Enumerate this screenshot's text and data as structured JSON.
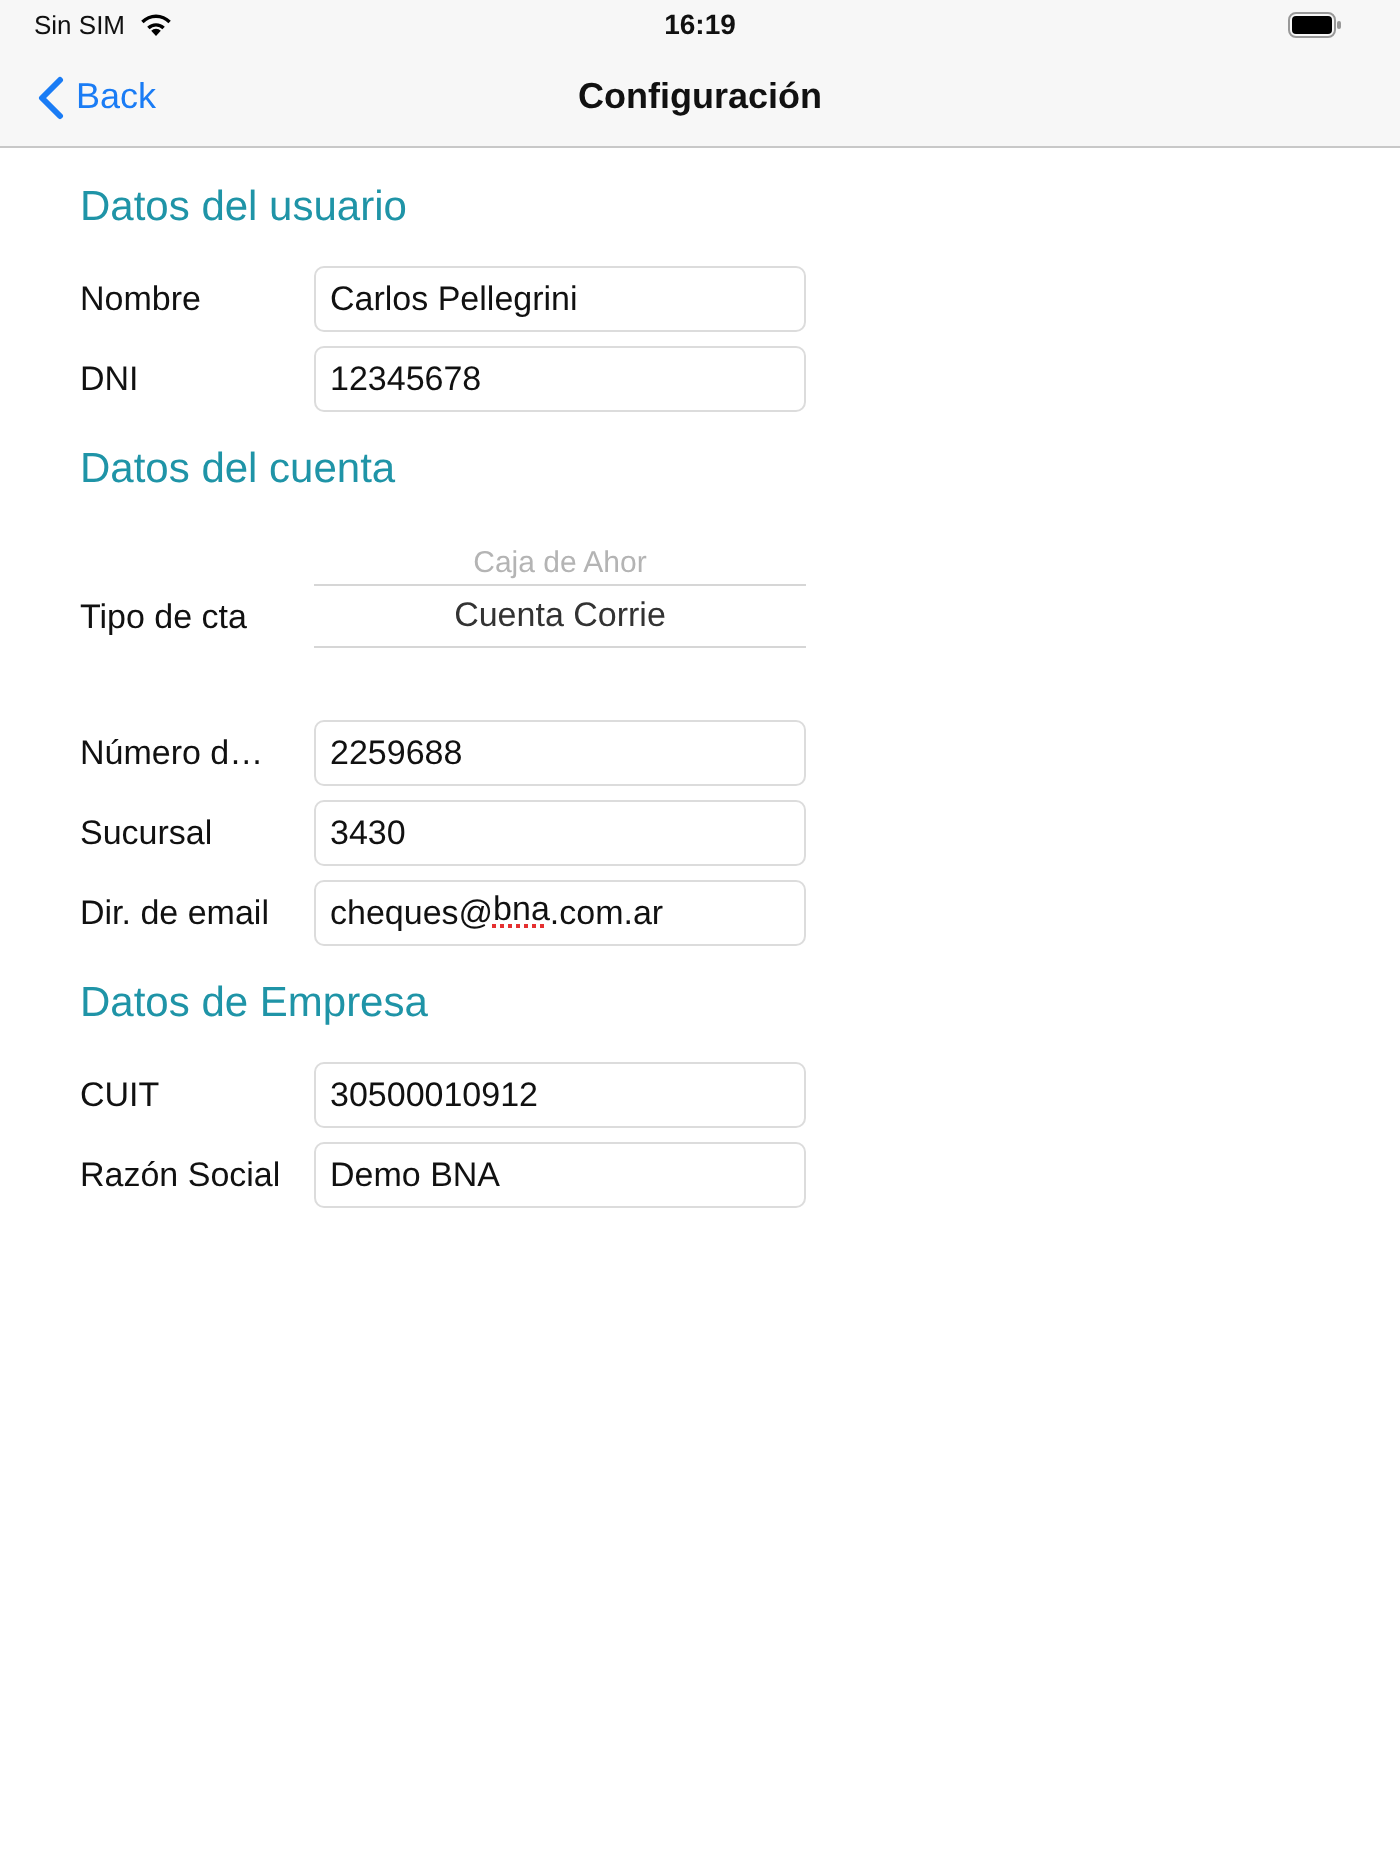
{
  "status_bar": {
    "carrier": "Sin SIM",
    "time": "16:19"
  },
  "nav_bar": {
    "back": "Back",
    "title": "Configuración"
  },
  "sections": [
    {
      "title": "Datos del usuario",
      "fields": [
        {
          "kind": "text",
          "label": "Nombre",
          "value": "Carlos Pellegrini"
        },
        {
          "kind": "text",
          "label": "DNI",
          "value": "12345678"
        }
      ]
    },
    {
      "title": "Datos del cuenta",
      "fields": [
        {
          "kind": "picker",
          "label": "Tipo de cta",
          "options": [
            {
              "label": "Caja de Ahor",
              "selected": false
            },
            {
              "label": "Cuenta Corrie",
              "selected": true
            }
          ]
        },
        {
          "kind": "text",
          "label": "Número d…",
          "value": "2259688"
        },
        {
          "kind": "text",
          "label": "Sucursal",
          "value": "3430"
        },
        {
          "kind": "text",
          "label": "Dir. de email",
          "value_parts": [
            {
              "text": "cheques@",
              "misspelled": false
            },
            {
              "text": "bna",
              "misspelled": true
            },
            {
              "text": ".com.ar",
              "misspelled": false
            }
          ]
        }
      ]
    },
    {
      "title": "Datos de Empresa",
      "fields": [
        {
          "kind": "text",
          "label": "CUIT",
          "value": "30500010912"
        },
        {
          "kind": "text",
          "label": "Razón Social",
          "value": "Demo BNA"
        }
      ]
    }
  ]
}
